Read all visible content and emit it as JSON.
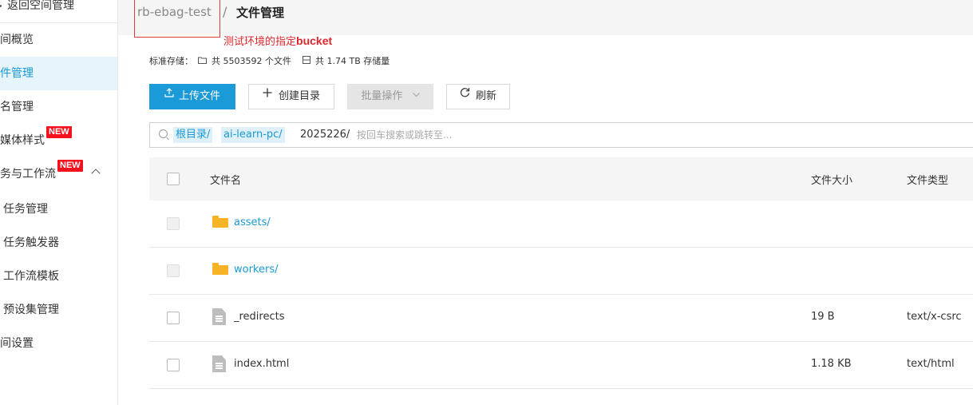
{
  "sidebar": {
    "back_label": "返回空间管理",
    "items": [
      {
        "label": "间概览"
      },
      {
        "label": "件管理"
      },
      {
        "label": "名管理"
      },
      {
        "label": "媒体样式",
        "badge": "NEW"
      },
      {
        "label": "务与工作流",
        "badge": "NEW"
      },
      {
        "label": "任务管理"
      },
      {
        "label": "任务触发器"
      },
      {
        "label": "工作流模板"
      },
      {
        "label": "预设集管理"
      },
      {
        "label": "间设置"
      }
    ]
  },
  "header": {
    "bucket": "rb-ebag-test",
    "separator": "/",
    "current": "文件管理"
  },
  "annotation": {
    "prefix": "测试环境的指定",
    "bold": "bucket",
    "color": "#e0262a"
  },
  "stats": {
    "storage_label": "标准存储：",
    "file_count_text": "共 5503592 个文件",
    "size_text": "共 1.74 TB 存储量"
  },
  "toolbar": {
    "upload_icon": "upload-icon",
    "upload_label": "上传文件",
    "mkdir_icon": "plus-icon",
    "mkdir_label": "创建目录",
    "batch_label": "批量操作",
    "batch_icon": "chevron-down-icon",
    "refresh_icon": "refresh-icon",
    "refresh_label": "刷新"
  },
  "pathbar": {
    "segments": [
      "根目录/",
      "ai-learn-pc/"
    ],
    "current": "2025226/",
    "placeholder": "按回车搜索或跳转至..."
  },
  "table": {
    "headers": {
      "name": "文件名",
      "size": "文件大小",
      "type": "文件类型"
    },
    "rows": [
      {
        "name": "assets/",
        "kind": "folder",
        "size": "",
        "type": ""
      },
      {
        "name": "workers/",
        "kind": "folder",
        "size": "",
        "type": ""
      },
      {
        "name": "_redirects",
        "kind": "file",
        "size": "19 B",
        "type": "text/x-csrc"
      },
      {
        "name": "index.html",
        "kind": "file",
        "size": "1.18 KB",
        "type": "text/html"
      }
    ]
  },
  "colors": {
    "accent": "#1a9ad6",
    "active_bg": "#e6f4fb",
    "badge": "#f5121d",
    "folder": "#f5b325"
  }
}
